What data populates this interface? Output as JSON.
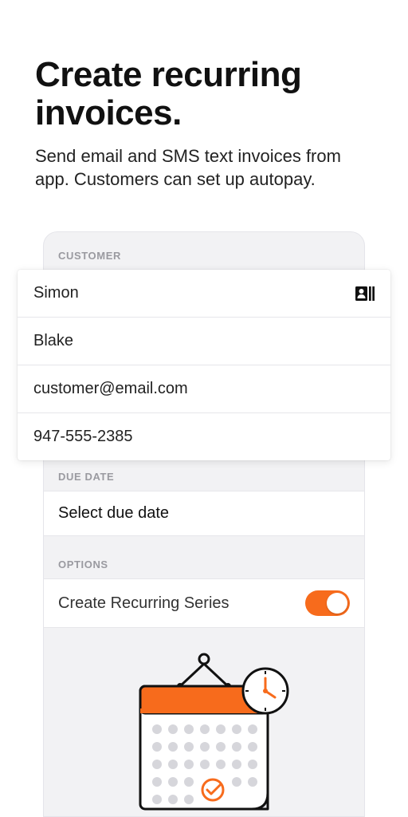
{
  "hero": {
    "title": "Create recurring invoices.",
    "subtitle": "Send email and SMS text invoices from app. Customers can set up autopay."
  },
  "sections": {
    "customer_label": "CUSTOMER",
    "due_date_label": "DUE DATE",
    "options_label": "OPTIONS"
  },
  "customer": {
    "first_name": "Simon",
    "last_name": "Blake",
    "email": "customer@email.com",
    "phone": "947-555-2385"
  },
  "due_date": {
    "placeholder": "Select due date"
  },
  "options": {
    "recurring_label": "Create Recurring Series",
    "recurring_on": true
  },
  "colors": {
    "accent": "#f76b1c"
  }
}
